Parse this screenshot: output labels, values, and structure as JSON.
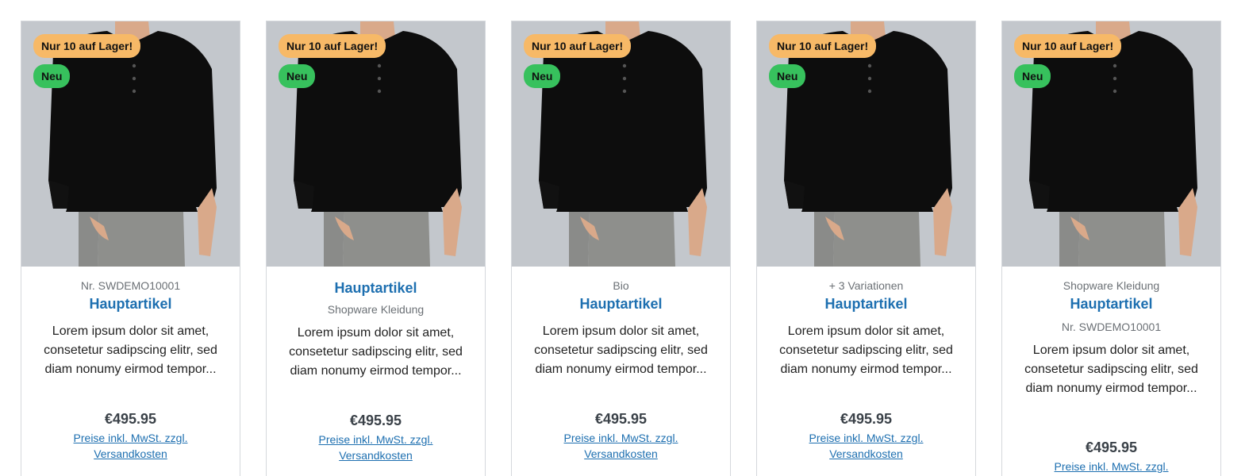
{
  "products": [
    {
      "badge_stock": "Nur 10 auf Lager!",
      "badge_new": "Neu",
      "above_name": "Nr.  SWDEMO10001",
      "name": "Hauptartikel",
      "below_name": "",
      "description": "Lorem ipsum dolor sit amet, consetetur sadipscing elitr, sed diam nonumy eirmod tempor...",
      "price": "€495.95",
      "tax_link": "Preise inkl. MwSt. zzgl. Versandkosten"
    },
    {
      "badge_stock": "Nur 10 auf Lager!",
      "badge_new": "Neu",
      "above_name": "",
      "name": "Hauptartikel",
      "below_name": "Shopware Kleidung",
      "description": "Lorem ipsum dolor sit amet, consetetur sadipscing elitr, sed diam nonumy eirmod tempor...",
      "price": "€495.95",
      "tax_link": "Preise inkl. MwSt. zzgl. Versandkosten"
    },
    {
      "badge_stock": "Nur 10 auf Lager!",
      "badge_new": "Neu",
      "above_name": "Bio",
      "name": "Hauptartikel",
      "below_name": "",
      "description": "Lorem ipsum dolor sit amet, consetetur sadipscing elitr, sed diam nonumy eirmod tempor...",
      "price": "€495.95",
      "tax_link": "Preise inkl. MwSt. zzgl. Versandkosten"
    },
    {
      "badge_stock": "Nur 10 auf Lager!",
      "badge_new": "Neu",
      "above_name": "+ 3 Variationen",
      "name": "Hauptartikel",
      "below_name": "",
      "description": "Lorem ipsum dolor sit amet, consetetur sadipscing elitr, sed diam nonumy eirmod tempor...",
      "price": "€495.95",
      "tax_link": "Preise inkl. MwSt. zzgl. Versandkosten"
    },
    {
      "badge_stock": "Nur 10 auf Lager!",
      "badge_new": "Neu",
      "above_name": "Shopware Kleidung",
      "name": "Hauptartikel",
      "below_name": "Nr.  SWDEMO10001",
      "description": "Lorem ipsum dolor sit amet, consetetur sadipscing elitr, sed diam nonumy eirmod tempor...",
      "price": "€495.95",
      "tax_link": "Preise inkl. MwSt. zzgl. Versandkosten"
    }
  ],
  "colors": {
    "accent": "#1d6fb0",
    "badge_stock": "#f7b967",
    "badge_new": "#37c15d",
    "image_bg": "#c3c7cc"
  },
  "icons": {
    "product_image": "black-long-sleeve-henley-shirt"
  }
}
